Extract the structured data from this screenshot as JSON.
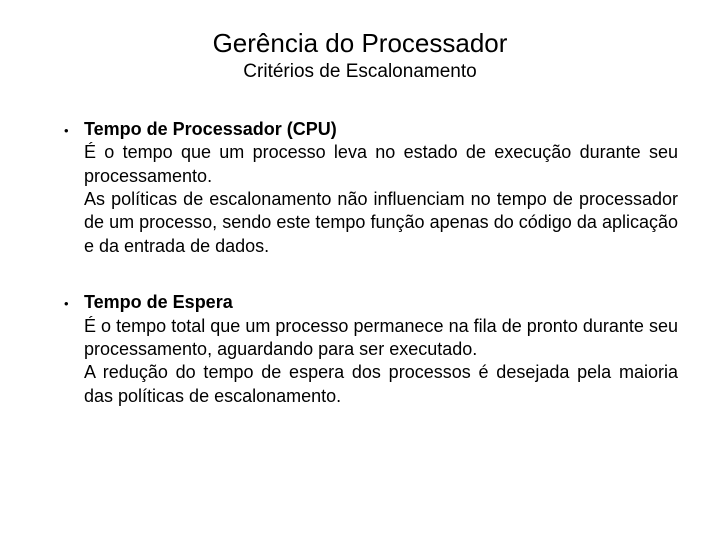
{
  "header": {
    "title": "Gerência do Processador",
    "subtitle": "Critérios de Escalonamento"
  },
  "sections": [
    {
      "heading": "Tempo de Processador (CPU)",
      "paragraphs": [
        "É o tempo que um processo leva no estado de execução durante seu processamento.",
        "As políticas de escalonamento não influenciam no tempo de processador de um processo, sendo este tempo função apenas do código da aplicação e da entrada de dados."
      ]
    },
    {
      "heading": "Tempo de Espera",
      "paragraphs": [
        "É o tempo total que um processo permanece na fila de pronto durante seu processamento, aguardando para ser executado.",
        "A redução do tempo de espera dos processos é desejada pela maioria das políticas de escalonamento."
      ]
    }
  ]
}
